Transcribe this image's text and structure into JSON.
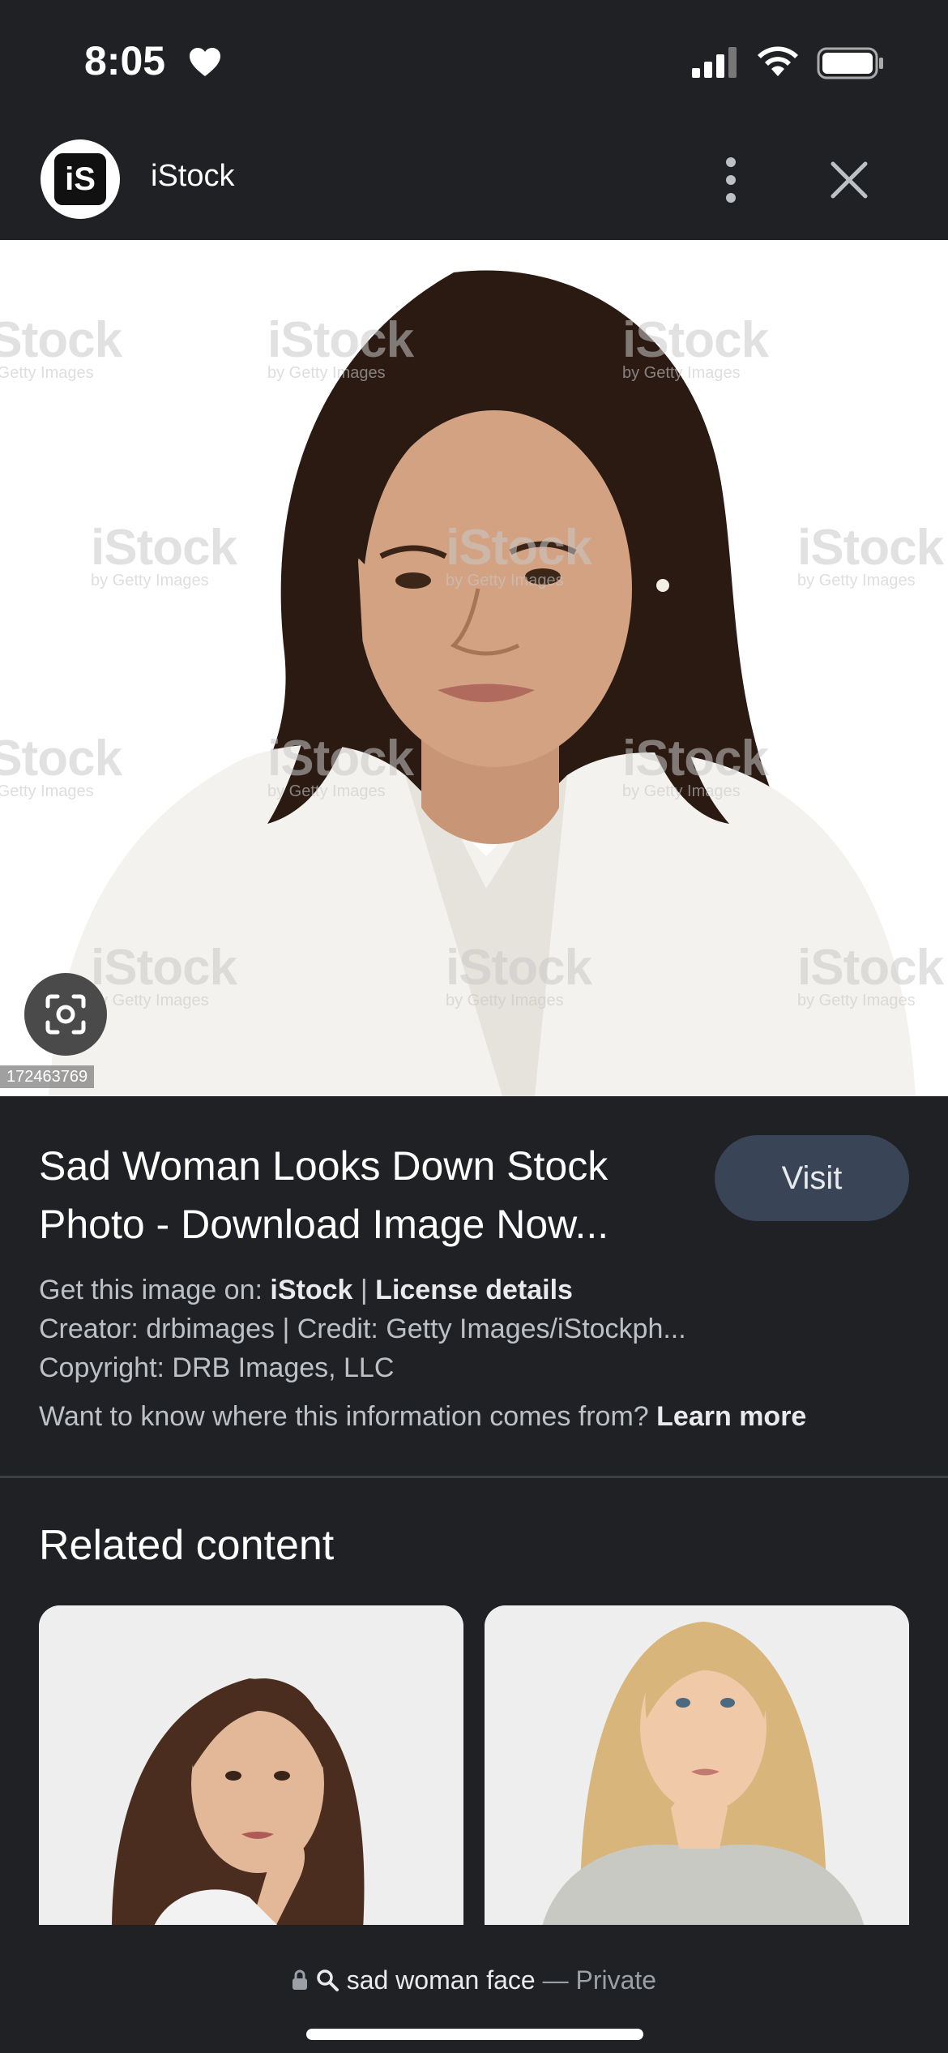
{
  "status_bar": {
    "time": "8:05"
  },
  "header": {
    "site_name": "iStock",
    "logo_text": "iS"
  },
  "image": {
    "watermark_text": "iStock",
    "watermark_sub": "by Getty Images",
    "image_id": "172463769"
  },
  "info": {
    "title": "Sad Woman Looks Down Stock Photo - Download Image Now...",
    "visit_label": "Visit",
    "get_image_prefix": "Get this image on:",
    "get_image_site": "iStock",
    "separator": "|",
    "license_link": "License details",
    "creator_line": "Creator: drbimages | Credit: Getty Images/iStockph...",
    "copyright_line": "Copyright: DRB Images, LLC",
    "info_question": "Want to know where this information comes from?",
    "learn_more": "Learn more"
  },
  "related": {
    "title": "Related content"
  },
  "bottom_bar": {
    "query": "sad woman face",
    "dash": "—",
    "private_label": "Private"
  },
  "colors": {
    "background": "#202124",
    "visit_button": "#394457",
    "secondary_text": "#bdc1c6"
  }
}
